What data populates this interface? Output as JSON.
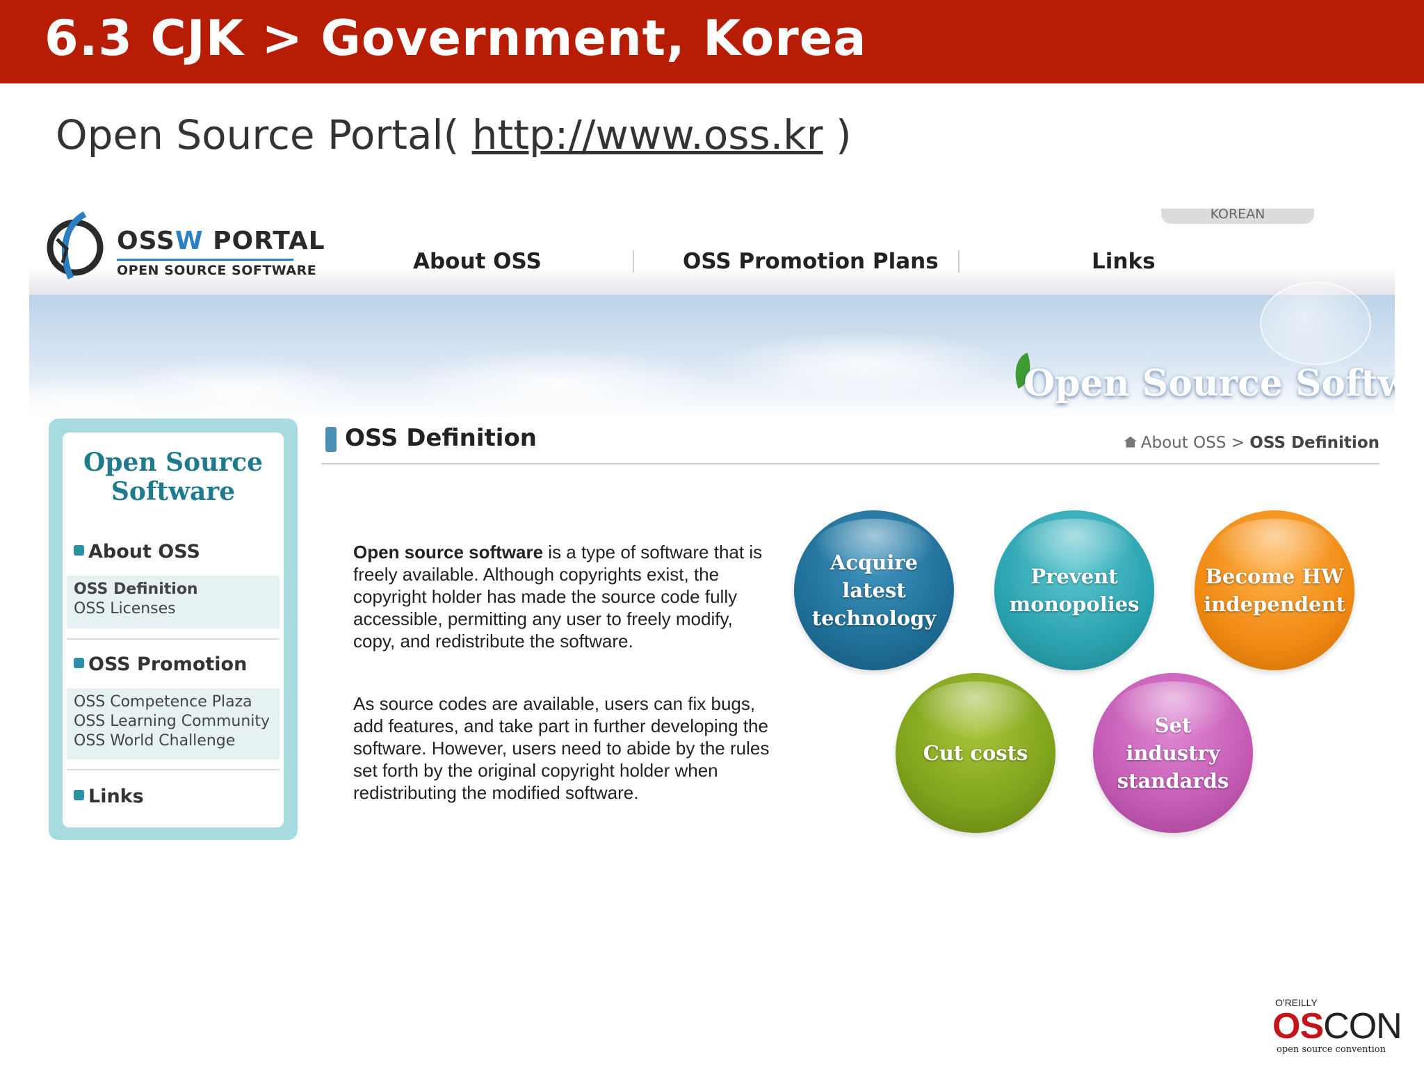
{
  "slide": {
    "title": "6.3 CJK > Government, Korea",
    "subtitle_prefix": "Open Source Portal( ",
    "subtitle_link": "http://www.oss.kr",
    "subtitle_suffix": " )"
  },
  "portal": {
    "language_tab": "KOREAN",
    "logo": {
      "main_prefix": "OSS",
      "main_sw": "W",
      "main_suffix": " PORTAL",
      "sub": "OPEN SOURCE SOFTWARE"
    },
    "nav": [
      "About OSS",
      "OSS Promotion Plans",
      "Links"
    ],
    "banner_title": "Open Source Software",
    "sidebar": {
      "title_line1": "Open Source",
      "title_line2": "Software",
      "sections": [
        {
          "label": "About OSS",
          "links": [
            "OSS Definition",
            "OSS Licenses"
          ],
          "active": "OSS Definition"
        },
        {
          "label": "OSS Promotion",
          "links": [
            "OSS Competence Plaza",
            "OSS Learning Community",
            "OSS World Challenge"
          ]
        },
        {
          "label": "Links",
          "links": []
        }
      ]
    },
    "content": {
      "title": "OSS Definition",
      "breadcrumb": {
        "parent": "About OSS",
        "sep": ">",
        "current": "OSS Definition"
      },
      "para1_bold": "Open source software",
      "para1_rest": " is a type of software that is freely available. Although copyrights exist, the copyright holder has made the source code fully accessible, permitting any user to freely modify, copy, and redistribute the software.",
      "para2": "As source codes are available, users can fix bugs, add features, and take part in further developing the software. However, users need to abide by the rules set forth by the original copyright holder when redistributing the modified software.",
      "bubbles": [
        {
          "label": "Acquire latest technology",
          "color": "#1f6f98"
        },
        {
          "label": "Prevent monopolies",
          "color": "#2aa3b0"
        },
        {
          "label": "Become HW independent",
          "color": "#f08a12"
        },
        {
          "label": "Cut costs",
          "color": "#7fa31c"
        },
        {
          "label": "Set industry standards",
          "color": "#c45ab4"
        }
      ]
    }
  },
  "footer_logo": {
    "publisher": "O'REILLY",
    "brand_os": "OS",
    "brand_con": "CON",
    "tagline": "open source convention"
  },
  "colors": {
    "title_bar": "#b71c05",
    "sidebar_frame": "#a8dbe0",
    "accent": "#2b8fa6"
  }
}
